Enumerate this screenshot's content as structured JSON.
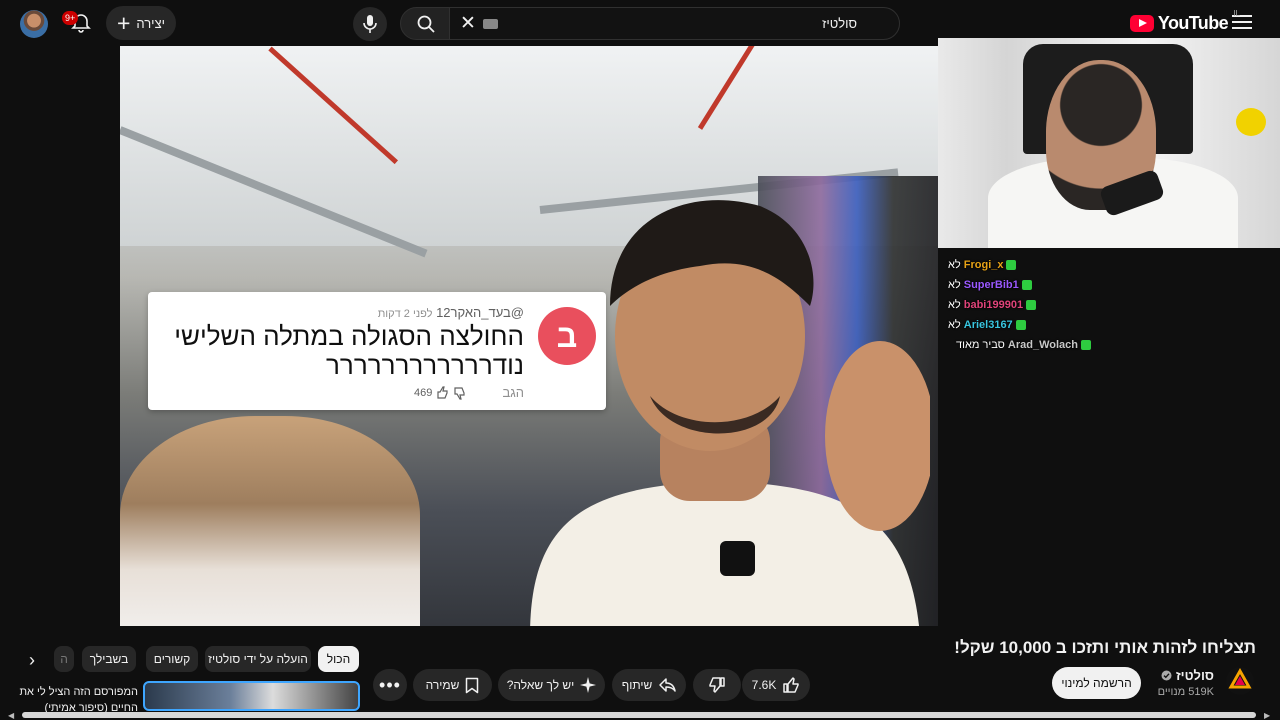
{
  "header": {
    "logo_text": "YouTube",
    "country_code": "IL",
    "search_value": "סולטיז",
    "create_label": "יצירה",
    "notifications_badge": "9+"
  },
  "video": {
    "comment_overlay": {
      "avatar_letter": "ב",
      "handle": "@בעד_האקר12",
      "time": "לפני 2 דקות",
      "text": "החולצה הסגולה במתלה השלישי נודרררררררררררר",
      "reply_label": "הגב",
      "likes": "469"
    },
    "stream_chat": [
      {
        "user": "Frogi_x",
        "message": "לא",
        "color": "#e8a317"
      },
      {
        "user": "SuperBib1",
        "message": "לא",
        "color": "#9b59ff"
      },
      {
        "user": "babi199901",
        "message": "לא",
        "color": "#e0447a"
      },
      {
        "user": "Ariel3167",
        "message": "לא",
        "color": "#39c6e0"
      },
      {
        "user": "Arad_Wolach",
        "message": "סביר מאוד",
        "color": "#c8c8c8"
      }
    ]
  },
  "info": {
    "title": "תצליחו לזהות אותי ותזכו ב 10,000 שקל!",
    "channel_name": "סולטיז",
    "subscribers": "519K מנויים",
    "subscribe_label": "הרשמה למינוי",
    "likes": "7.6K",
    "share_label": "שיתוף",
    "ask_label": "יש לך שאלה?",
    "save_label": "שמירה"
  },
  "chips": {
    "all": "הכול",
    "by_channel": "הועלה על ידי סולטיז",
    "related": "קשורים",
    "for_you": "בשבילך",
    "partial": "ה"
  },
  "recommendation": {
    "title": "המפורסם הזה הציל לי את החיים (סיפור אמיתי)"
  },
  "colors": {
    "brand_red": "#ff0033",
    "accent_blue": "#3ea6ff",
    "comment_avatar": "#e94f5d"
  }
}
